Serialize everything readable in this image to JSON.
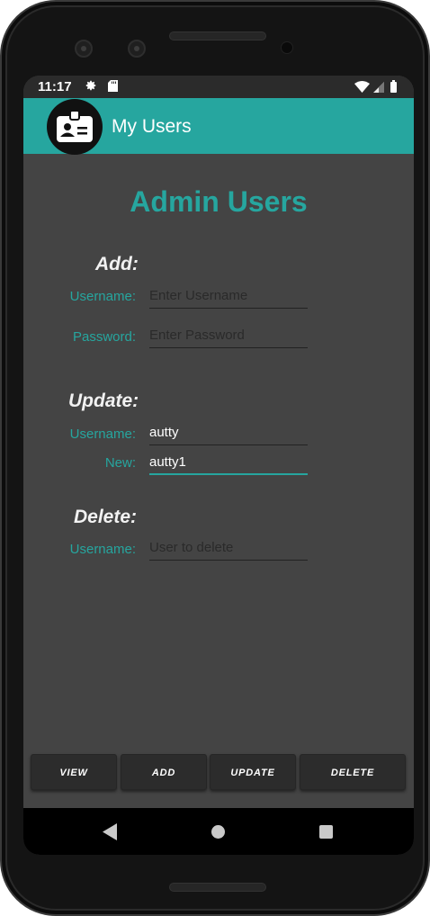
{
  "status": {
    "time": "11:17"
  },
  "appbar": {
    "title": "My Users"
  },
  "page": {
    "title": "Admin Users"
  },
  "add": {
    "section": "Add:",
    "username_label": "Username:",
    "username_placeholder": "Enter Username",
    "password_label": "Password:",
    "password_placeholder": "Enter Password"
  },
  "update": {
    "section": "Update:",
    "username_label": "Username:",
    "username_value": "autty",
    "new_label": "New:",
    "new_value": "autty1"
  },
  "delete": {
    "section": "Delete:",
    "username_label": "Username:",
    "username_placeholder": "User to delete"
  },
  "buttons": {
    "view": "VIEW",
    "add": "ADD",
    "update": "UPDATE",
    "delete": "DELETE"
  },
  "colors": {
    "accent": "#26a69f",
    "background": "#444444",
    "status_bar": "#2b2b2b",
    "button": "#2c2c2c"
  },
  "icons": {
    "status": [
      "settings-gear-icon",
      "sd-card-icon",
      "wifi-icon",
      "cell-signal-icon",
      "battery-icon"
    ],
    "app": "id-badge-icon",
    "nav": [
      "back-triangle-icon",
      "home-circle-icon",
      "recents-square-icon"
    ]
  }
}
